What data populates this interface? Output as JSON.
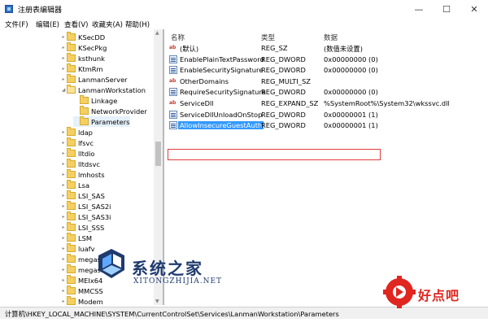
{
  "window": {
    "title": "注册表编辑器",
    "controls": {
      "minimize": "—",
      "maximize": "☐",
      "close": "✕"
    }
  },
  "menu": [
    "文件(F)",
    "编辑(E)",
    "查看(V)",
    "收藏夹(A)",
    "帮助(H)"
  ],
  "tree": {
    "items": [
      {
        "label": "KSecDD",
        "expander": "▸",
        "state": "closed"
      },
      {
        "label": "KSecPkg",
        "expander": "▸",
        "state": "closed"
      },
      {
        "label": "ksthunk",
        "expander": "▸",
        "state": "closed"
      },
      {
        "label": "KtmRm",
        "expander": "▸",
        "state": "closed"
      },
      {
        "label": "LanmanServer",
        "expander": "▸",
        "state": "closed"
      },
      {
        "label": "LanmanWorkstation",
        "expander": "◢",
        "state": "open"
      },
      {
        "label": "Linkage",
        "expander": "",
        "state": "child"
      },
      {
        "label": "NetworkProvider",
        "expander": "",
        "state": "child"
      },
      {
        "label": "Parameters",
        "expander": "",
        "state": "selected"
      },
      {
        "label": "ldap",
        "expander": "▸",
        "state": "closed"
      },
      {
        "label": "lfsvc",
        "expander": "▸",
        "state": "closed"
      },
      {
        "label": "lltdio",
        "expander": "▸",
        "state": "closed"
      },
      {
        "label": "lltdsvc",
        "expander": "▸",
        "state": "closed"
      },
      {
        "label": "lmhosts",
        "expander": "▸",
        "state": "closed"
      },
      {
        "label": "Lsa",
        "expander": "▸",
        "state": "closed"
      },
      {
        "label": "LSI_SAS",
        "expander": "▸",
        "state": "closed"
      },
      {
        "label": "LSI_SAS2i",
        "expander": "▸",
        "state": "closed"
      },
      {
        "label": "LSI_SAS3i",
        "expander": "▸",
        "state": "closed"
      },
      {
        "label": "LSI_SSS",
        "expander": "▸",
        "state": "closed"
      },
      {
        "label": "LSM",
        "expander": "▸",
        "state": "closed"
      },
      {
        "label": "luafv",
        "expander": "▸",
        "state": "closed"
      },
      {
        "label": "megasas",
        "expander": "▸",
        "state": "closed"
      },
      {
        "label": "megasr",
        "expander": "▸",
        "state": "closed"
      },
      {
        "label": "MEIx64",
        "expander": "▸",
        "state": "closed"
      },
      {
        "label": "MMCSS",
        "expander": "▸",
        "state": "closed"
      },
      {
        "label": "Modem",
        "expander": "▸",
        "state": "closed"
      }
    ]
  },
  "values": {
    "headers": {
      "name": "名称",
      "type": "类型",
      "data": "数据"
    },
    "rows": [
      {
        "icon": "string",
        "name": "(默认)",
        "type": "REG_SZ",
        "data": "(数值未设置)"
      },
      {
        "icon": "binary",
        "name": "EnablePlainTextPassword",
        "type": "REG_DWORD",
        "data": "0x00000000 (0)"
      },
      {
        "icon": "binary",
        "name": "EnableSecuritySignature",
        "type": "REG_DWORD",
        "data": "0x00000000 (0)"
      },
      {
        "icon": "string",
        "name": "OtherDomains",
        "type": "REG_MULTI_SZ",
        "data": ""
      },
      {
        "icon": "binary",
        "name": "RequireSecuritySignature",
        "type": "REG_DWORD",
        "data": "0x00000000 (0)"
      },
      {
        "icon": "string",
        "name": "ServiceDll",
        "type": "REG_EXPAND_SZ",
        "data": "%SystemRoot%\\System32\\wkssvc.dll"
      },
      {
        "icon": "binary",
        "name": "ServiceDllUnloadOnStop",
        "type": "REG_DWORD",
        "data": "0x00000001 (1)"
      },
      {
        "icon": "binary",
        "name": "AllowInsecureGuestAuth",
        "type": "REG_DWORD",
        "data": "0x00000001 (1)",
        "selected": true
      }
    ]
  },
  "statusbar": {
    "path": "计算机\\HKEY_LOCAL_MACHINE\\SYSTEM\\CurrentControlSet\\Services\\LanmanWorkstation\\Parameters"
  },
  "watermarks": {
    "left": {
      "cn": "系统之家",
      "en": "XITONGZHIJIA.NET"
    },
    "right": {
      "text": "好点吧"
    }
  },
  "colors": {
    "selection": "#3399ff",
    "highlight_box": "#e03a3a",
    "folder": "#f4cf61",
    "watermark_blue": "#1f3b6e",
    "watermark_red": "#e0261f"
  }
}
